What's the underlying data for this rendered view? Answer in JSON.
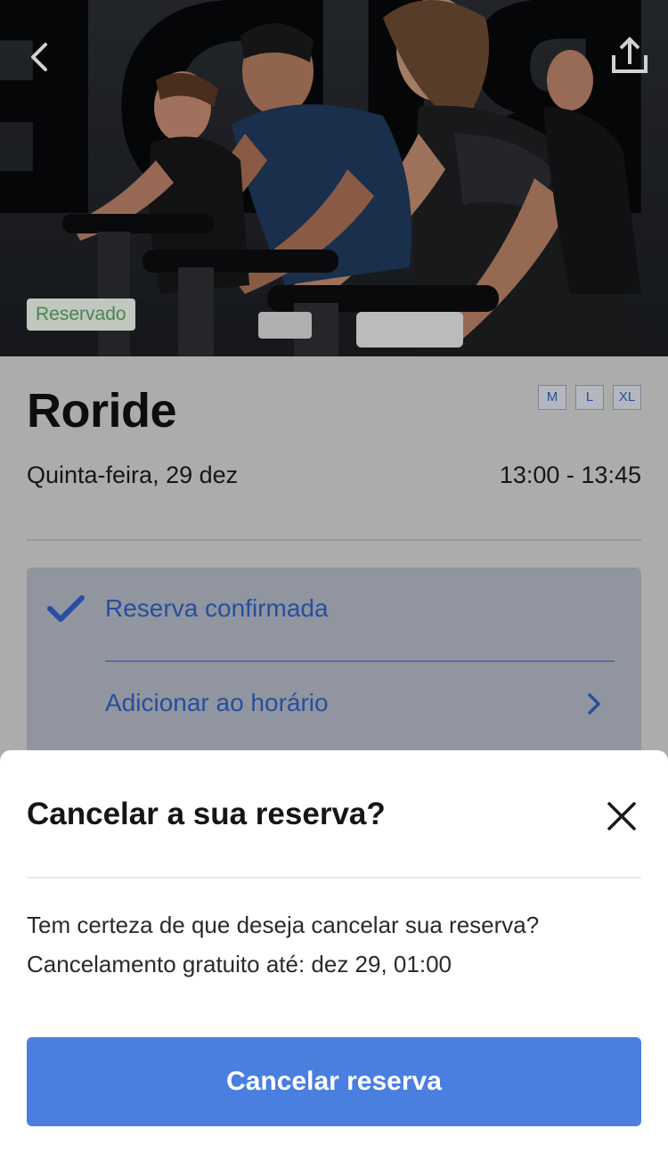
{
  "hero": {
    "status_badge": "Reservado",
    "back_icon": "chevron-left-icon",
    "share_icon": "share-upload-icon"
  },
  "class_info": {
    "title": "Roride",
    "sizes": [
      "M",
      "L",
      "XL"
    ],
    "date": "Quinta-feira, 29 dez",
    "time": "13:00 - 13:45"
  },
  "booking_card": {
    "confirmed_label": "Reserva confirmada",
    "confirmed_icon": "checkmark-icon",
    "add_schedule_label": "Adicionar ao horário",
    "add_schedule_icon": "chevron-right-icon"
  },
  "cancel_sheet": {
    "title": "Cancelar a sua reserva?",
    "close_icon": "close-icon",
    "message_line1": "Tem certeza de que deseja cancelar sua reserva?",
    "message_line2": "Cancelamento gratuito até: dez 29, 01:00",
    "cancel_button_label": "Cancelar reserva"
  },
  "colors": {
    "accent_blue": "#4a7fe0",
    "link_blue": "#2f61c2",
    "badge_green": "#5ca06a",
    "badge_bg": "#eaf3e8"
  }
}
